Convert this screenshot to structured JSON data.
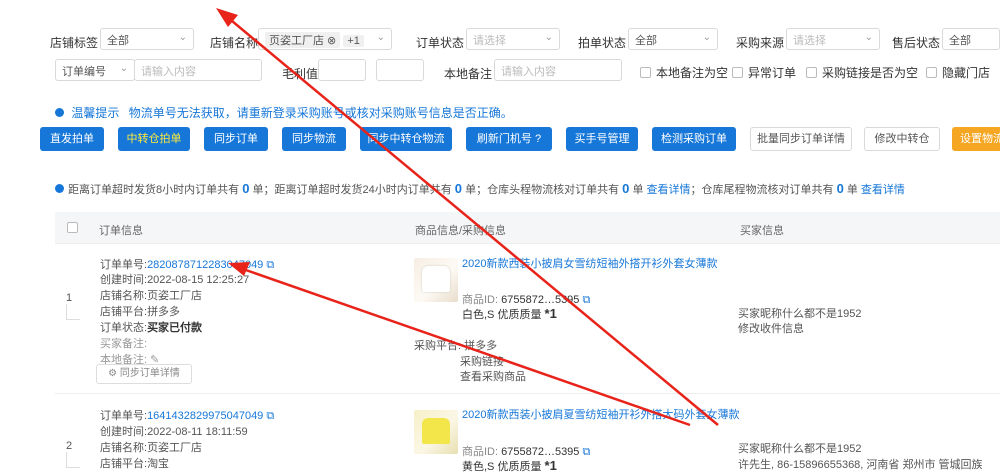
{
  "filters": {
    "row1": [
      {
        "label": "店铺标签",
        "value": "全部"
      },
      {
        "label": "店铺名称",
        "chip": "页姿工厂店",
        "more": "+1"
      },
      {
        "label": "订单状态",
        "placeholder": "请选择"
      },
      {
        "label": "拍单状态",
        "value": "全部"
      },
      {
        "label": "采购来源",
        "placeholder": "请选择"
      },
      {
        "label": "售后状态",
        "value": "全部"
      }
    ],
    "row2": {
      "order_type": "订单编号",
      "order_placeholder": "请输入内容",
      "profit_label": "毛利值",
      "note_label": "本地备注",
      "note_placeholder": "请输入内容",
      "checks": [
        "本地备注为空",
        "异常订单",
        "采购链接是否为空",
        "隐藏门店"
      ]
    }
  },
  "tip": {
    "label": "温馨提示",
    "text": "物流单号无法获取，请重新登录采购账号或核对采购账号信息是否正确。"
  },
  "toolbar": [
    "直发拍单",
    "中转仓拍单",
    "同步订单",
    "同步物流",
    "同步中转仓物流",
    "刷新门机号",
    "买手号管理",
    "检测采购订单",
    "批量同步订单详情",
    "修改中转仓",
    "设置物流"
  ],
  "summary": {
    "seg1": "距离订单超时发货8小时内订单共有",
    "n1": "0",
    "seg2": "单；距离订单超时发货24小时内订单共有",
    "n2": "0",
    "seg3": "单；仓库头程物流核对订单共有",
    "n3": "0",
    "seg4": "单",
    "link": "查看详情",
    "seg5": "；仓库尾程物流核对订单共有",
    "n4": "0",
    "seg6": "单"
  },
  "table": {
    "headers": [
      "订单信息",
      "商品信息/采购信息",
      "买家信息"
    ]
  },
  "orders": [
    {
      "index": "1",
      "order_no_label": "订单单号:",
      "order_no": "2820878712283047049",
      "created_label": "创建时间:",
      "created": "2022-08-15 12:25:27",
      "shop_label": "店铺名称:",
      "shop": "页姿工厂店",
      "platform_label": "店铺平台:",
      "platform": "拼多多",
      "status_label": "订单状态:",
      "status": "买家已付款",
      "buyer_note_label": "买家备注:",
      "local_note_label": "本地备注:",
      "sync_btn": "同步订单详情",
      "product_title": "2020新款西装小披肩女雪纺短袖外搭开衫外套女薄款",
      "product_id_label": "商品ID:",
      "product_id": "6755872…5395",
      "spec": "白色,S 优质质量",
      "qty": "*1",
      "purchase_label": "采购平台:",
      "purchase_platform": "拼多多",
      "purchase_link1": "采购链接",
      "purchase_link2": "查看采购商品",
      "buyer": "买家昵称什么都不是1952",
      "buyer_link": "修改收件信息"
    },
    {
      "index": "2",
      "order_no_label": "订单单号:",
      "order_no": "1641432829975047049",
      "created_label": "创建时间:",
      "created": "2022-08-11 18:11:59",
      "shop_label": "店铺名称:",
      "shop": "页姿工厂店",
      "platform_label": "店铺平台:",
      "platform": "淘宝",
      "product_title": "2020新款西装小披肩夏雪纺短袖开衫外搭大码外套女薄款",
      "product_id_label": "商品ID:",
      "product_id": "6755872…5395",
      "spec": "黄色,S 优质质量",
      "qty": "*1",
      "buyer": "买家昵称什么都不是1952",
      "buyer_line2": "许先生, 86-15896655368, 河南省 郑州市 管城回族"
    }
  ],
  "colors": {
    "primary": "#1677d8",
    "accent_yellow": "#ffeb3b",
    "orange": "#f5a623",
    "annotation_red": "#e8231a"
  }
}
